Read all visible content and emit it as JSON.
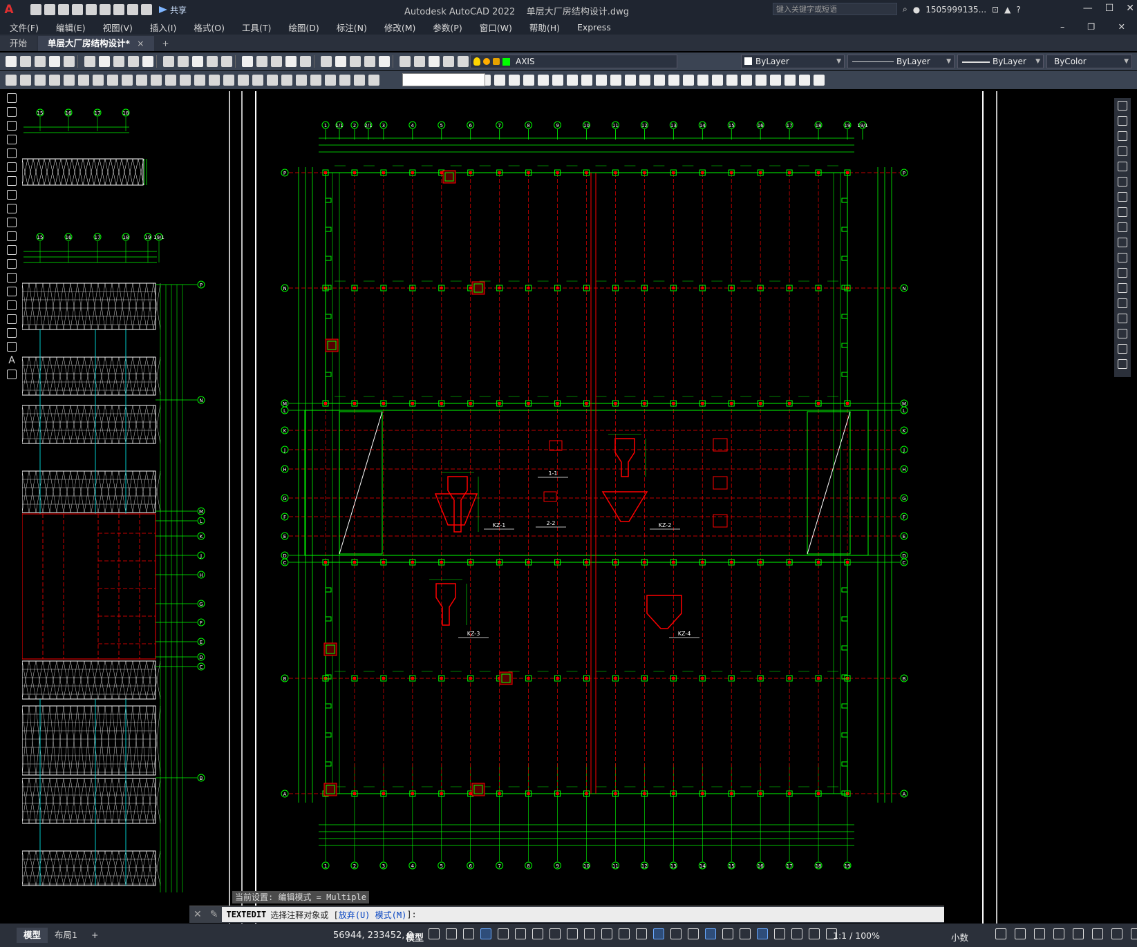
{
  "app": {
    "logo": "A",
    "title": "Autodesk AutoCAD 2022",
    "file": "单层大厂房结构设计.dwg",
    "share_label": "共享",
    "search_placeholder": "键入关键字或短语",
    "user": "1505999135...",
    "help": "?"
  },
  "menu": [
    "文件(F)",
    "编辑(E)",
    "视图(V)",
    "插入(I)",
    "格式(O)",
    "工具(T)",
    "绘图(D)",
    "标注(N)",
    "修改(M)",
    "参数(P)",
    "窗口(W)",
    "帮助(H)",
    "Express"
  ],
  "tabs": {
    "start": "开始",
    "active": "单层大厂房结构设计*",
    "close": "×",
    "add": "+"
  },
  "properties": {
    "layer": "AXIS",
    "color": "ByLayer",
    "linetype": "ByLayer",
    "lineweight": "ByLayer",
    "plotstyle": "ByColor"
  },
  "colors": {
    "grid_green": "#00ff00",
    "column_red": "#ff0000",
    "axis_red": "#cc0000",
    "text_white": "#ffffff"
  },
  "drawing": {
    "top_axes": [
      "1",
      "1/1",
      "2",
      "2/1",
      "3",
      "4",
      "5",
      "6",
      "7",
      "8",
      "9",
      "10",
      "11",
      "12",
      "13",
      "14",
      "15",
      "16",
      "17",
      "18",
      "19",
      "19/1"
    ],
    "bottom_axes": [
      "1",
      "2",
      "3",
      "4",
      "5",
      "6",
      "7",
      "8",
      "9",
      "10",
      "11",
      "12",
      "13",
      "14",
      "15",
      "16",
      "17",
      "18",
      "19"
    ],
    "row_labels": [
      "P",
      "N",
      "M",
      "L",
      "K",
      "J",
      "H",
      "G",
      "F",
      "E",
      "D",
      "C",
      "B",
      "A"
    ],
    "left_panel_axes_top": [
      "15",
      "16",
      "17",
      "18"
    ],
    "left_panel_axes_mid": [
      "15",
      "16",
      "17",
      "18",
      "19",
      "19/1"
    ],
    "left_panel_rows": [
      "P",
      "N",
      "M",
      "L",
      "K",
      "J",
      "H",
      "G",
      "F",
      "E",
      "D",
      "C",
      "B"
    ],
    "column_tags": [
      "KZ-1",
      "KZ-2",
      "KZ-3",
      "KZ-4"
    ],
    "section_tags": [
      "1-1",
      "2-2"
    ]
  },
  "command": {
    "history": "当前设置: 编辑模式 = Multiple",
    "name": "TEXTEDIT",
    "prompt": "选择注释对象或 [",
    "opt1": "放弃(U)",
    "opt2": "模式(M)",
    "end": "]:"
  },
  "status": {
    "tab_model": "模型",
    "tab_layout": "布局1",
    "tab_add": "+",
    "coords": "56944, 233452, 0",
    "space": "模型",
    "scale": "1:1 / 100%",
    "units": "小数"
  }
}
